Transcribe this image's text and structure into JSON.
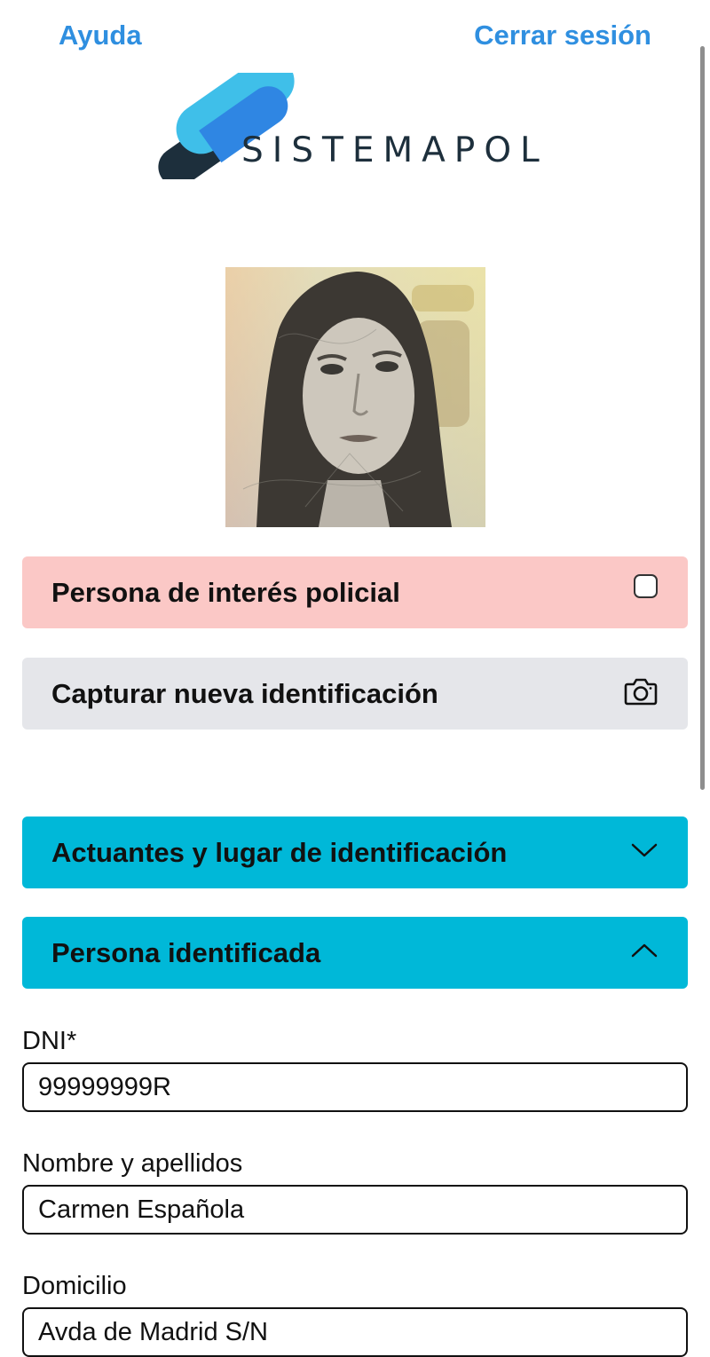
{
  "header": {
    "help_label": "Ayuda",
    "logout_label": "Cerrar sesión"
  },
  "logo": {
    "text": "SISTEMAPOL",
    "colors": {
      "dark": "#1d2f3c",
      "light_blue": "#3fbfe9",
      "blue": "#2f86e3"
    }
  },
  "profile": {
    "photo_icon": "person-photo"
  },
  "interest": {
    "label": "Persona de interés policial",
    "checked": false
  },
  "capture": {
    "label": "Capturar nueva identificación",
    "icon": "camera-icon"
  },
  "sections": {
    "actuantes": {
      "label": "Actuantes y lugar de identificación",
      "expanded": false,
      "icon": "chevron-down-icon"
    },
    "persona": {
      "label": "Persona identificada",
      "expanded": true,
      "icon": "chevron-up-icon"
    }
  },
  "form": {
    "dni": {
      "label": "DNI*",
      "value": "99999999R"
    },
    "nombre": {
      "label": "Nombre y apellidos",
      "value": "Carmen Española"
    },
    "domicilio": {
      "label": "Domicilio",
      "value": "Avda de Madrid S/N"
    }
  },
  "colors": {
    "link": "#2f8fe0",
    "interest_bg": "#fbc8c6",
    "capture_bg": "#e5e6ea",
    "section_bg": "#00b8d8"
  }
}
